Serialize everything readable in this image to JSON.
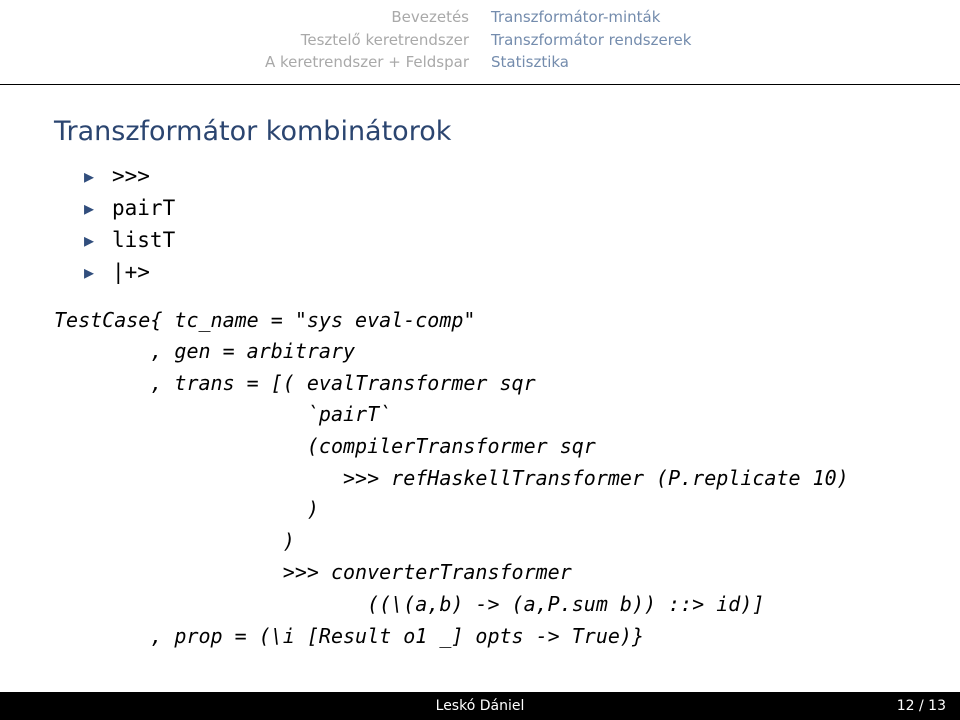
{
  "head": {
    "left": [
      "Bevezetés",
      "Tesztelő keretrendszer",
      "A keretrendszer + Feldspar"
    ],
    "right": [
      "Transzformátor-minták",
      "Transzformátor rendszerek",
      "Statisztika"
    ]
  },
  "title": "Transzformátor kombinátorok",
  "bullets": [
    ">>>",
    "pairT",
    "listT",
    "|+>"
  ],
  "code": "TestCase{ tc_name = \"sys eval-comp\"\n        , gen = arbitrary\n        , trans = [( evalTransformer sqr\n                     `pairT`\n                     (compilerTransformer sqr\n                        >>> refHaskellTransformer (P.replicate 10)\n                     )\n                   )\n                   >>> converterTransformer\n                          ((\\(a,b) -> (a,P.sum b)) ::> id)]\n        , prop = (\\i [Result o1 _] opts -> True)}",
  "footer": {
    "author": "Leskó Dániel",
    "page": "12 / 13"
  }
}
